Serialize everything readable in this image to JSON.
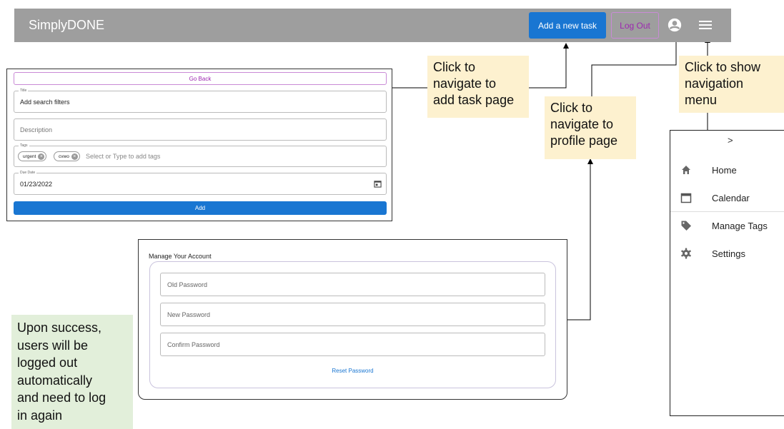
{
  "appbar": {
    "brand": "SimplyDONE",
    "add_task_label": "Add a new task",
    "logout_label": "Log Out",
    "account_icon": "account-circle-icon",
    "menu_icon": "hamburger-menu-icon"
  },
  "callouts": {
    "add_task": [
      "Click to",
      "navigate to",
      "add task page"
    ],
    "profile": [
      "Click to",
      "navigate to",
      "profile page"
    ],
    "nav_menu": [
      "Click to show",
      "navigation",
      "menu"
    ],
    "success": [
      "Upon success,",
      "users will be",
      "logged out",
      "automatically",
      "and need to log",
      "in again"
    ]
  },
  "task_form": {
    "go_back_label": "Go Back",
    "title_label": "Title",
    "title_value": "Add search filters",
    "description_placeholder": "Description",
    "tags_label": "Tags",
    "tags": [
      "urgent",
      "cvwo"
    ],
    "tags_placeholder": "Select or Type to add tags",
    "due_label": "Due Date",
    "due_value": "01/23/2022",
    "add_label": "Add"
  },
  "account": {
    "title": "Manage Your Account",
    "old_password_placeholder": "Old Password",
    "new_password_placeholder": "New Password",
    "confirm_password_placeholder": "Confirm Password",
    "reset_label": "Reset Password"
  },
  "drawer": {
    "chevron": ">",
    "items": [
      {
        "label": "Home",
        "icon": "home-icon"
      },
      {
        "label": "Calendar",
        "icon": "calendar-icon"
      },
      {
        "label": "Manage Tags",
        "icon": "tag-icon"
      },
      {
        "label": "Settings",
        "icon": "gear-icon"
      }
    ]
  },
  "colors": {
    "primary": "#1976d2",
    "secondary": "#9c27b0",
    "appbar": "#9e9e9e",
    "callout_yellow": "#fdf1cf",
    "callout_green": "#e2efda"
  }
}
